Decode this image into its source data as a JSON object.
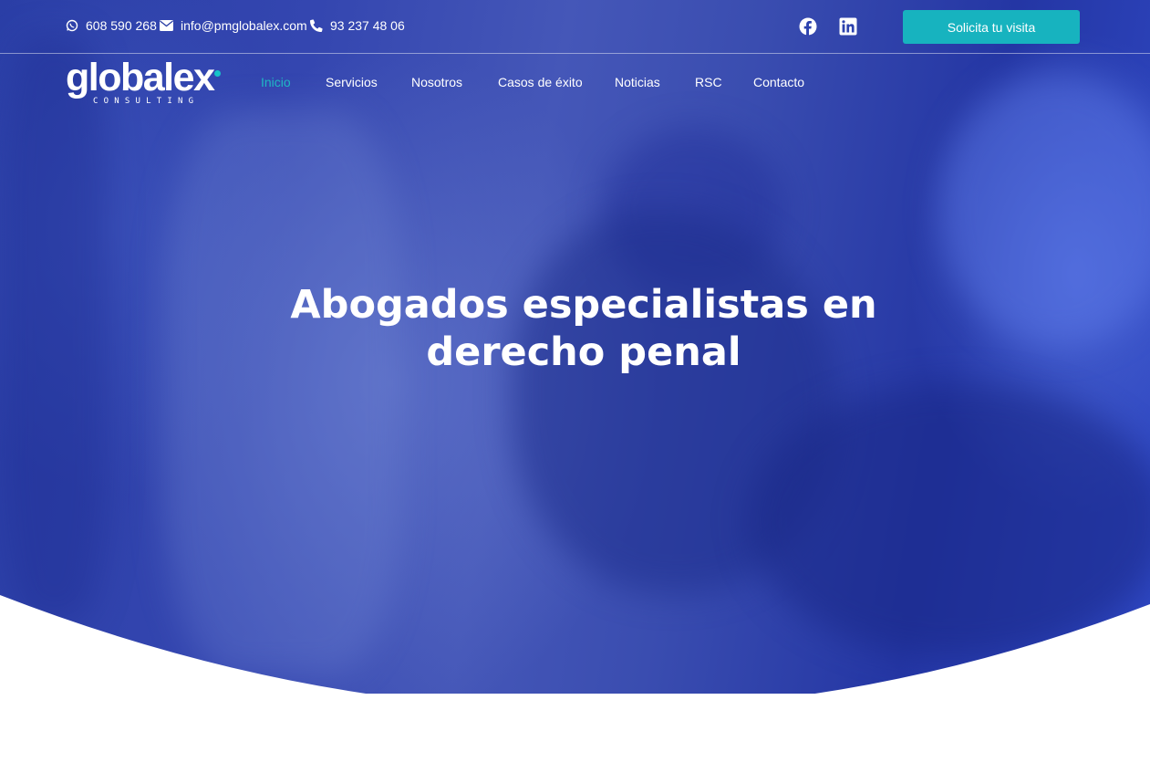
{
  "topbar": {
    "whatsapp": "608 590 268",
    "email": "info@pmglobalex.com",
    "phone": "93 237 48 06",
    "cta_label": "Solicita tu visita",
    "social": [
      "facebook-icon",
      "linkedin-icon"
    ]
  },
  "logo": {
    "word": "globalex",
    "sub": "CONSULTING"
  },
  "nav": {
    "items": [
      "Inicio",
      "Servicios",
      "Nosotros",
      "Casos de éxito",
      "Noticias",
      "RSC",
      "Contacto"
    ],
    "active": "Inicio"
  },
  "hero": {
    "headline_line1": "Abogados especialistas en",
    "headline_line2": "derecho penal"
  },
  "colors": {
    "accent": "#17b3bf",
    "hero_blue": "#2a3ea6",
    "active_nav": "#1fb8c4"
  }
}
